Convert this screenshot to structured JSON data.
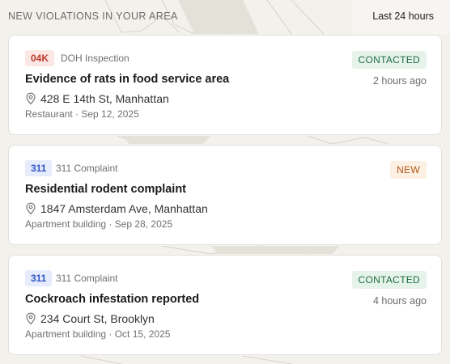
{
  "header": {
    "title": "NEW VIOLATIONS IN YOUR AREA",
    "time_range": "Last 24 hours"
  },
  "colors": {
    "doh_badge_bg": "#fbe7e4",
    "doh_badge_text": "#c0392b",
    "c311_badge_bg": "#e6ecfb",
    "c311_badge_text": "#2f54c6",
    "contacted_bg": "#e5f3ea",
    "contacted_text": "#1f6b3f",
    "new_bg": "#fcf0e2",
    "new_text": "#b4561b"
  },
  "violations": [
    {
      "badge": "04K",
      "badge_type": "doh",
      "source": "DOH Inspection",
      "status": "CONTACTED",
      "title": "Evidence of rats in food service area",
      "time_ago": "2 hours ago",
      "address": "428 E 14th St, Manhattan",
      "meta": "Restaurant · Sep 12, 2025",
      "icon": "map-pin-icon"
    },
    {
      "badge": "311",
      "badge_type": "311",
      "source": "311 Complaint",
      "status": "NEW",
      "title": "Residential rodent complaint",
      "time_ago": "",
      "address": "1847 Amsterdam Ave, Manhattan",
      "meta": "Apartment building · Sep 28, 2025",
      "icon": "map-pin-icon"
    },
    {
      "badge": "311",
      "badge_type": "311",
      "source": "311 Complaint",
      "status": "CONTACTED",
      "title": "Cockroach infestation reported",
      "time_ago": "4 hours ago",
      "address": "234 Court St, Brooklyn",
      "meta": "Apartment building · Oct 15, 2025",
      "icon": "map-pin-icon"
    }
  ]
}
